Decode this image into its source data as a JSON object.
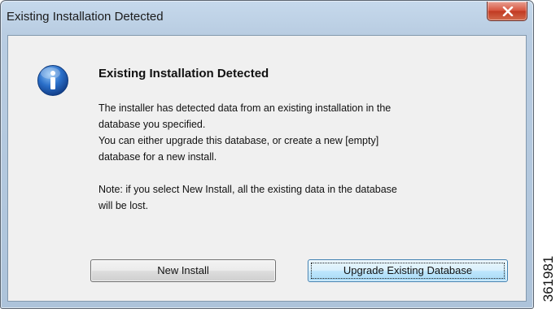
{
  "window": {
    "title": "Existing Installation Detected",
    "close_icon": "close-x-icon"
  },
  "dialog": {
    "icon": "info-icon",
    "heading": "Existing Installation Detected",
    "message_lines": [
      "The installer has detected data from an existing installation in the",
      "database you specified.",
      "You can either upgrade this database, or create a new [empty]",
      "database for a new install."
    ],
    "note_lines": [
      "Note:  if you select New Install, all the existing data in the database",
      "will be lost."
    ],
    "buttons": {
      "new_install": "New Install",
      "upgrade": "Upgrade Existing Database"
    }
  },
  "figure_id": "361981",
  "colors": {
    "close_button": "#d7553f",
    "info_icon": "#2a6fc9",
    "default_button_border": "#3c7fb1"
  }
}
